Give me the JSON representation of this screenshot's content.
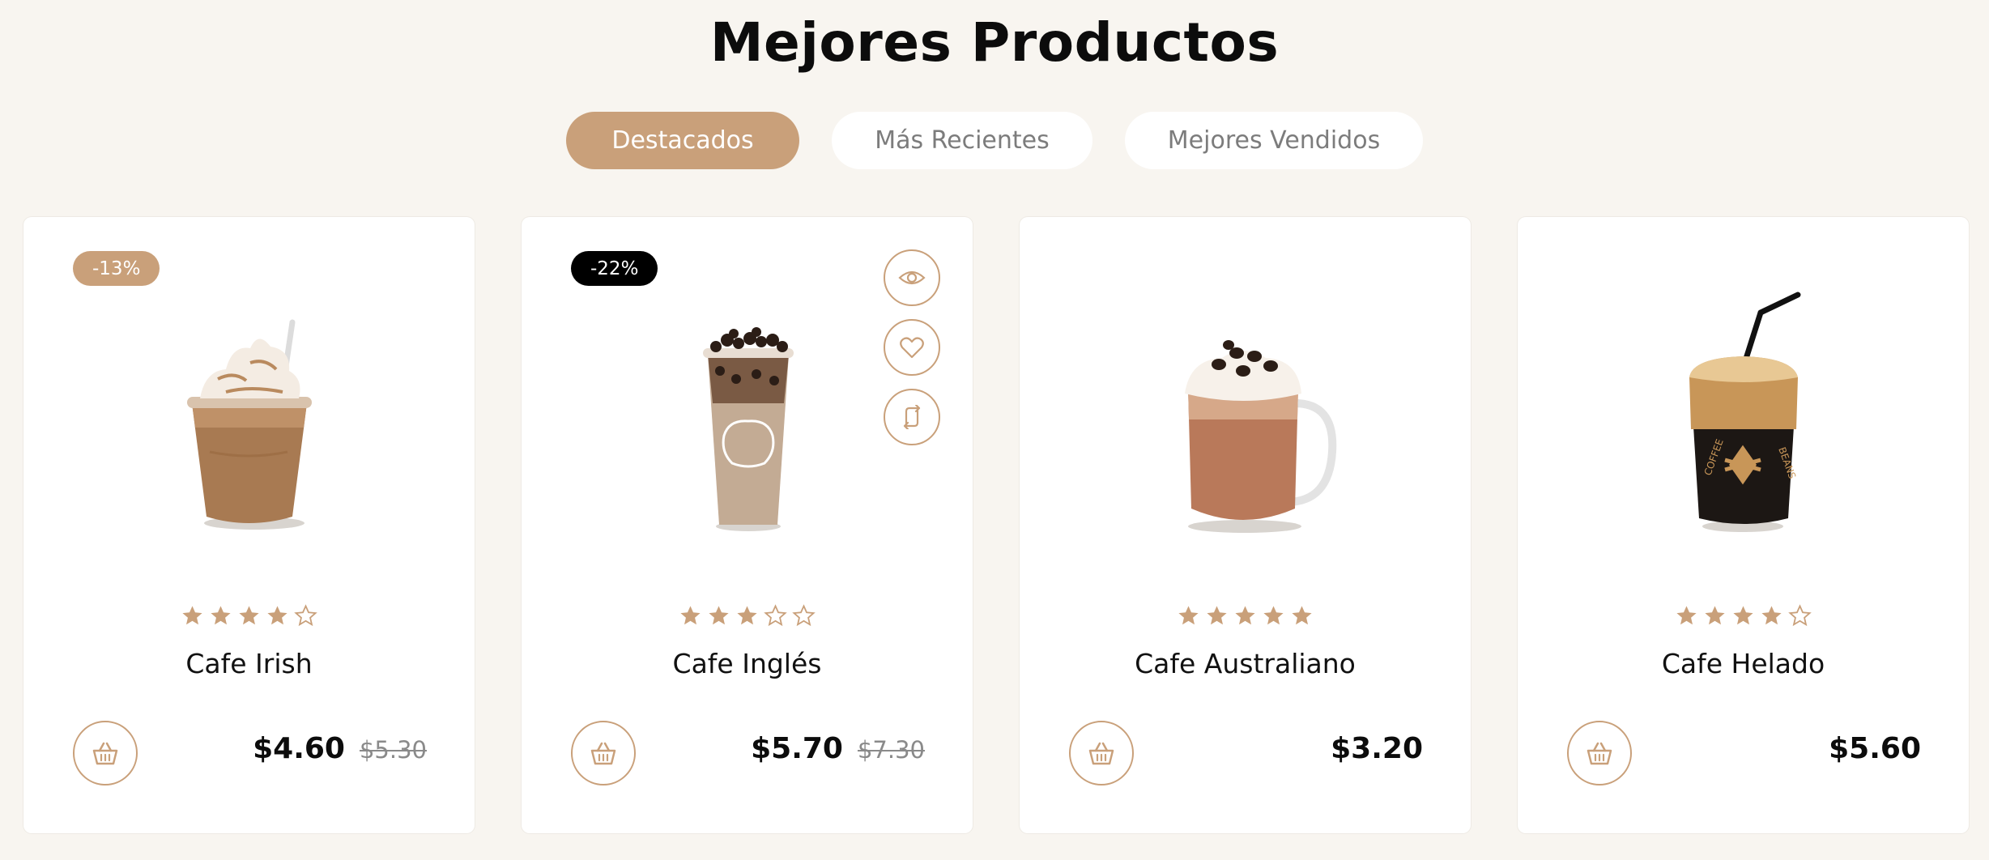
{
  "section": {
    "title": "Mejores Productos"
  },
  "tabs": [
    {
      "label": "Destacados",
      "active": true
    },
    {
      "label": "Más Recientes",
      "active": false
    },
    {
      "label": "Mejores Vendidos",
      "active": false
    }
  ],
  "colors": {
    "accent": "#c9a07a",
    "background": "#f8f5f0",
    "badge_dark": "#000000"
  },
  "products": [
    {
      "name": "Cafe Irish",
      "price": "$4.60",
      "old_price": "$5.30",
      "discount": "-13%",
      "rating": 4,
      "max_rating": 5,
      "image": "iced-frappe-cup-icon"
    },
    {
      "name": "Cafe Inglés",
      "price": "$5.70",
      "old_price": "$7.30",
      "discount": "-22%",
      "rating": 3,
      "max_rating": 5,
      "image": "bubble-tea-cup-icon"
    },
    {
      "name": "Cafe Australiano",
      "price": "$3.20",
      "old_price": "",
      "discount": "",
      "rating": 5,
      "max_rating": 5,
      "image": "glass-mug-coffee-icon"
    },
    {
      "name": "Cafe Helado",
      "price": "$5.60",
      "old_price": "",
      "discount": "",
      "rating": 4,
      "max_rating": 5,
      "image": "iced-coffee-straw-icon"
    }
  ],
  "card_actions": [
    {
      "name": "quick-view",
      "icon": "eye-icon"
    },
    {
      "name": "wishlist",
      "icon": "heart-icon"
    },
    {
      "name": "compare",
      "icon": "compare-arrows-icon"
    }
  ]
}
